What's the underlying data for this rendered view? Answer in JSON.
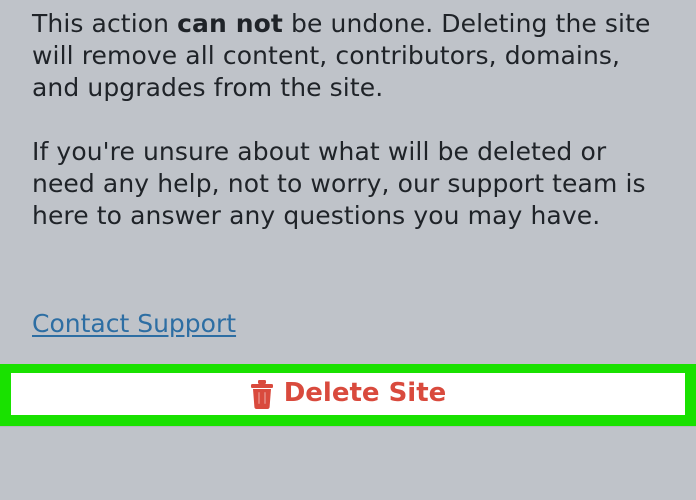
{
  "warning": {
    "prefix": "This action ",
    "emphasis": "can not",
    "suffix": " be undone. Deleting the site will remove all content, contributors, domains, and upgrades from the site."
  },
  "support_text": "If you're unsure about what will be deleted or need any help, not to worry, our support team is here to answer any questions you may have.",
  "contact_support": {
    "label": "Contact Support"
  },
  "delete_site": {
    "label": "Delete Site",
    "icon": "trash-icon"
  },
  "colors": {
    "background": "#bfc3c9",
    "text": "#1f2328",
    "link": "#2d6ea3",
    "delete": "#d94a3d",
    "highlight": "#19e100",
    "button_background": "#ffffff"
  }
}
